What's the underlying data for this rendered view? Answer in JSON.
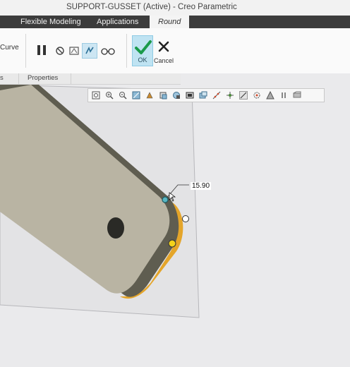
{
  "window": {
    "title": "SUPPORT-GUSSET (Active) - Creo Parametric"
  },
  "menu": {
    "tabs": [
      {
        "label": "Flexible Modeling",
        "active": false
      },
      {
        "label": "Applications",
        "active": false
      },
      {
        "label": "Round",
        "active": true
      }
    ]
  },
  "ribbon": {
    "curve_label": "Curve",
    "ok_label": "OK",
    "cancel_label": "Cancel"
  },
  "subtabs": [
    {
      "label": "s"
    },
    {
      "label": "Properties"
    }
  ],
  "viewport": {
    "dimension_value": "15.90"
  },
  "colors": {
    "menubar": "#3c3c3c",
    "part_face": "#b9b4a3",
    "part_edge": "#5f5d50",
    "round_highlight": "#e4a52a",
    "handle_yellow": "#f3d21b",
    "sketch_plane": "#e3e3e5",
    "ok_accent": "#1a9a4a"
  },
  "graphics_toolbar": {
    "icons": [
      "refit-icon",
      "zoom-in-icon",
      "zoom-out-icon",
      "repaint-icon",
      "reorient-icon",
      "saved-orientations-icon",
      "view-manager-icon",
      "display-style-icon",
      "datum-display-icon",
      "annotation-display-icon",
      "spin-center-icon",
      "select-icon",
      "appearance-icon",
      "simulation-icon",
      "pause-icon",
      "settings-icon"
    ]
  }
}
